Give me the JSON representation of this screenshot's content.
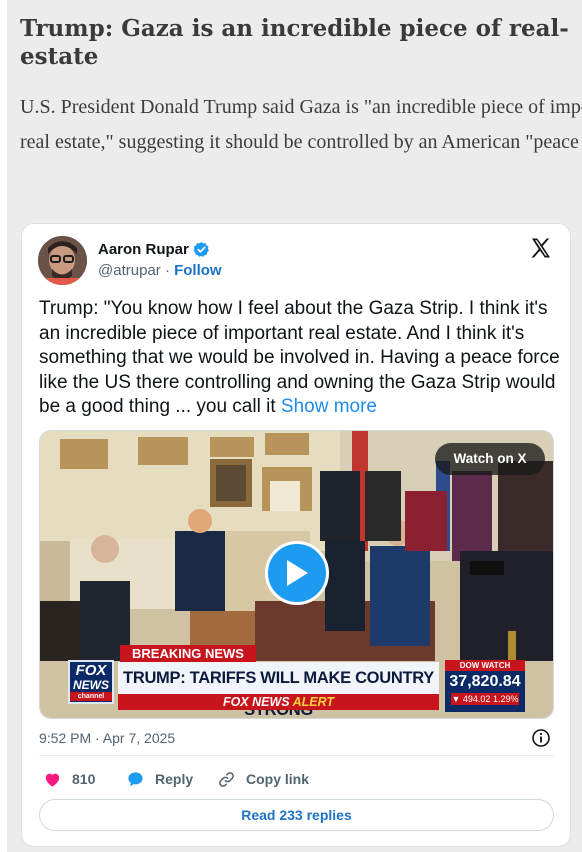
{
  "article": {
    "headline": "Trump: Gaza is an incredible piece of real-estate",
    "summary": "U.S. President Donald Trump said Gaza is \"an incredible piece of important real estate,\" suggesting it should be controlled by an American \"peace force.\""
  },
  "tweet": {
    "author_name": "Aaron Rupar",
    "handle": "@atrupar",
    "separator": "·",
    "follow_label": "Follow",
    "text": "Trump: \"You know how I feel about the Gaza Strip. I think it's an incredible piece of important real estate. And I think it's something that we would be involved in. Having a peace force like the US there controlling and owning the Gaza Strip would be a good thing ... you call it ",
    "show_more_label": "Show more",
    "timestamp": "9:52 PM · Apr 7, 2025",
    "like_count": "810",
    "reply_label": "Reply",
    "copy_link_label": "Copy link",
    "read_replies_label": "Read 233 replies"
  },
  "video": {
    "watch_label": "Watch on X",
    "breaking_label": "BREAKING NEWS",
    "channel_line1": "FOX",
    "channel_line2": "NEWS",
    "channel_line3": "channel",
    "headline": "TRUMP: TARIFFS WILL MAKE COUNTRY STRONG",
    "alert_brand": "FOX NEWS",
    "alert_word": "ALERT",
    "dow_label": "DOW WATCH",
    "dow_value": "37,820.84",
    "dow_change": "▼ 494.02",
    "dow_pct": "1.29%"
  },
  "colors": {
    "accent_blue": "#1d9bf0",
    "link_blue": "#1d72c4",
    "like_pink": "#f91880",
    "fox_red": "#c8141c",
    "fox_navy": "#0b2a66"
  },
  "icons": {
    "verified": "verified-badge-icon",
    "brand": "x-logo-icon",
    "play": "play-icon",
    "info": "info-icon",
    "like": "heart-icon",
    "reply": "speech-bubble-icon",
    "copy": "link-icon"
  }
}
